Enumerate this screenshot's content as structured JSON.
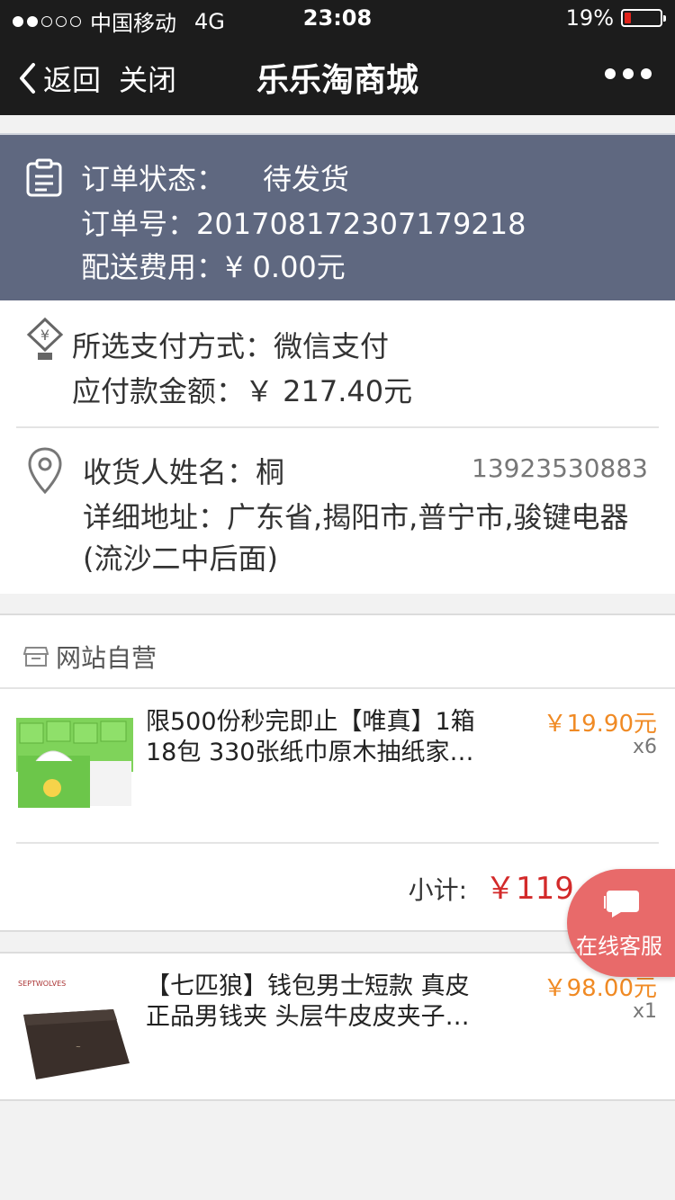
{
  "status_bar": {
    "carrier": "中国移动",
    "network": "4G",
    "time": "23:08",
    "battery": "19%",
    "battery_level": 0.19
  },
  "nav": {
    "back_label": "返回",
    "close_label": "关闭",
    "title": "乐乐淘商城"
  },
  "order": {
    "status_label": "订单状态：",
    "status_value": "待发货",
    "number_line": "订单号：20170817230717921 8",
    "number_text": "订单号：201708172307179218",
    "shipping_text": "配送费用：¥ 0.00元"
  },
  "payment": {
    "method_text": "所选支付方式：微信支付",
    "amount_text": "应付款金额：￥ 217.40元"
  },
  "address": {
    "name_text": "收货人姓名：桐",
    "phone": "13923530883",
    "detail_text": "详细地址：广东省,揭阳市,普宁市,骏键电器",
    "detail_text2": "(流沙二中后面)"
  },
  "shop": {
    "name": "网站自营",
    "products": [
      {
        "name_line1": "限500份秒完即止【唯真】1箱",
        "name_line2": "18包 330张纸巾原木抽纸家…",
        "price": "￥19.90元",
        "qty": "x6"
      },
      {
        "name_line1": "【七匹狼】钱包男士短款 真皮",
        "name_line2": "正品男钱夹 头层牛皮皮夹子…",
        "price": "￥98.00元",
        "qty": "x1"
      }
    ],
    "subtotal_label": "小计:",
    "subtotal_value": "￥119.40元"
  },
  "service_button": {
    "label": "在线客服"
  },
  "colors": {
    "nav_bg": "#1c1c1c",
    "status_block": "#5f6880",
    "price_orange": "#f08a24",
    "subtotal_red": "#d32a2a",
    "service_bg": "#e86a6a"
  }
}
